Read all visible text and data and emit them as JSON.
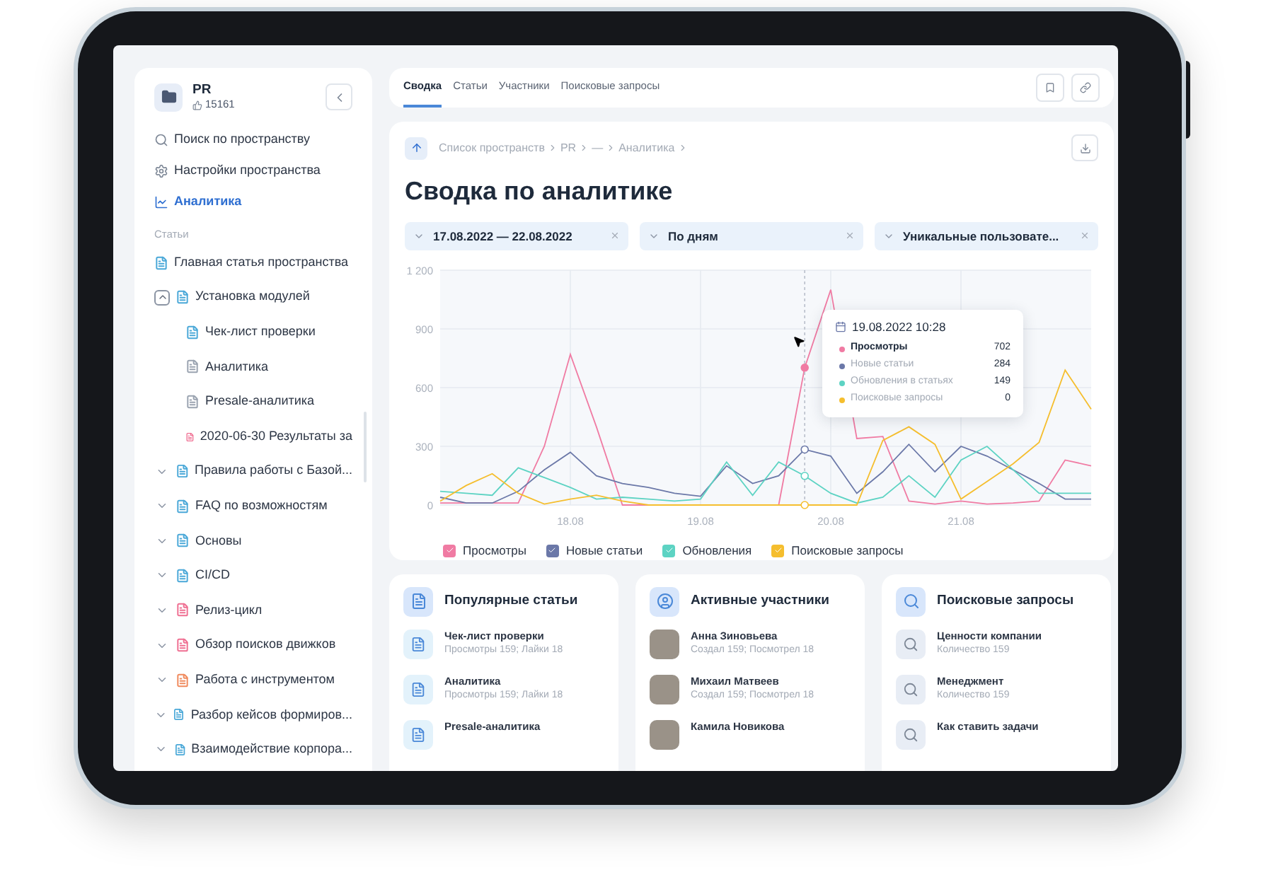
{
  "sidebar": {
    "space": {
      "name": "PR",
      "likes": "15161"
    },
    "nav": [
      {
        "kind": "search",
        "label": "Поиск по пространству",
        "selected": false
      },
      {
        "kind": "settings",
        "label": "Настройки пространства",
        "selected": false
      },
      {
        "kind": "analytics",
        "label": "Аналитика",
        "selected": true
      }
    ],
    "section_label": "Статьи",
    "tree": [
      {
        "kind": "page",
        "label": "Главная статья пространства",
        "color": "#4aa8d8"
      },
      {
        "kind": "folder",
        "label": "Установка модулей",
        "color": "#4aa8d8",
        "expanded": true,
        "children": [
          {
            "label": "Чек-лист проверки",
            "color": "#4aa8d8"
          },
          {
            "label": "Аналитика",
            "color": "#9aa3b0"
          },
          {
            "label": "Presale-аналитика",
            "color": "#9aa3b0"
          },
          {
            "label": "2020-06-30 Результаты за",
            "color": "#ef6f92"
          }
        ]
      },
      {
        "kind": "folder",
        "label": "Правила работы с Базой...",
        "color": "#4aa8d8",
        "expanded": false
      },
      {
        "kind": "folder",
        "label": "FAQ по возможностям",
        "color": "#4aa8d8",
        "expanded": false
      },
      {
        "kind": "folder",
        "label": "Основы",
        "color": "#4aa8d8",
        "expanded": false
      },
      {
        "kind": "folder",
        "label": "CI/CD",
        "color": "#4aa8d8",
        "expanded": false
      },
      {
        "kind": "folder",
        "label": "Релиз-цикл",
        "color": "#ef6f92",
        "expanded": false
      },
      {
        "kind": "folder",
        "label": "Обзор поисков движков",
        "color": "#ef6f92",
        "expanded": false
      },
      {
        "kind": "folder",
        "label": "Работа с инструментом",
        "color": "#f08a5d",
        "expanded": false
      },
      {
        "kind": "folder",
        "label": "Разбор кейсов формиров...",
        "color": "#4aa8d8",
        "expanded": false
      },
      {
        "kind": "folder",
        "label": "Взаимодействие корпора...",
        "color": "#4aa8d8",
        "expanded": false
      }
    ]
  },
  "tabs": [
    {
      "label": "Сводка",
      "selected": true
    },
    {
      "label": "Статьи",
      "selected": false
    },
    {
      "label": "Участники",
      "selected": false
    },
    {
      "label": "Поисковые запросы",
      "selected": false
    }
  ],
  "breadcrumbs": [
    "Список пространств",
    "PR",
    "—",
    "Аналитика"
  ],
  "title": "Сводка по аналитике",
  "filters": [
    {
      "value": "17.08.2022 — 22.08.2022"
    },
    {
      "value": "По дням"
    },
    {
      "value": "Уникальные пользовате..."
    }
  ],
  "chart_data": {
    "type": "line",
    "ylim": [
      0,
      1200
    ],
    "categories": [
      null,
      null,
      null,
      null,
      null,
      "18.08",
      null,
      null,
      null,
      null,
      "19.08",
      null,
      null,
      null,
      null,
      "20.08",
      null,
      null,
      null,
      null,
      "21.08",
      null,
      null,
      null,
      null,
      null
    ],
    "yticks": [
      0,
      300,
      600,
      900,
      {
        "value": 1200,
        "label": "1 200"
      }
    ],
    "series": [
      {
        "name": "Просмотры",
        "color": "#f07ba3",
        "values": [
          10,
          10,
          10,
          10,
          300,
          770,
          400,
          0,
          0,
          0,
          0,
          0,
          0,
          0,
          702,
          1100,
          340,
          350,
          20,
          5,
          20,
          5,
          10,
          20,
          230,
          200
        ]
      },
      {
        "name": "Новые статьи",
        "color": "#6b78a8",
        "values": [
          40,
          10,
          10,
          70,
          180,
          270,
          150,
          110,
          90,
          60,
          45,
          200,
          110,
          150,
          284,
          250,
          60,
          170,
          310,
          170,
          300,
          250,
          180,
          110,
          30,
          30
        ]
      },
      {
        "name": "Обновления",
        "color": "#5dd3c3",
        "values": [
          70,
          60,
          50,
          190,
          140,
          90,
          30,
          40,
          30,
          20,
          30,
          220,
          50,
          220,
          149,
          60,
          10,
          40,
          150,
          40,
          230,
          300,
          180,
          60,
          60,
          60
        ]
      },
      {
        "name": "Поисковые запросы",
        "color": "#f5be2e",
        "values": [
          20,
          100,
          160,
          60,
          5,
          30,
          50,
          20,
          0,
          0,
          0,
          0,
          0,
          0,
          0,
          0,
          0,
          330,
          400,
          310,
          30,
          120,
          210,
          320,
          690,
          490
        ]
      }
    ],
    "grid": true
  },
  "legend": [
    {
      "checked": true
    },
    {
      "checked": true
    },
    {
      "checked": true
    },
    {
      "checked": true
    }
  ],
  "tooltip": {
    "date": "19.08.2022 10:28",
    "rows": [
      {
        "label": "Просмотры",
        "value": "702",
        "color": "#f07ba3",
        "selected": true
      },
      {
        "label": "Новые статьи",
        "value": "284",
        "color": "#6b78a8",
        "selected": false
      },
      {
        "label": "Обновления в статьях",
        "value": "149",
        "color": "#5dd3c3",
        "selected": false
      },
      {
        "label": "Поисковые запросы",
        "value": "0",
        "color": "#f5be2e",
        "selected": false
      }
    ]
  },
  "panels": [
    {
      "kind": "articles",
      "title": "Популярные статьи",
      "items": [
        {
          "title": "Чек-лист проверки",
          "subtitle": "Просмотры 159; Лайки 18"
        },
        {
          "title": "Аналитика",
          "subtitle": "Просмотры 159; Лайки 18"
        },
        {
          "title": "Presale-аналитика"
        }
      ]
    },
    {
      "kind": "members",
      "title": "Активные участники",
      "items": [
        {
          "title": "Анна Зиновьева",
          "subtitle": "Создал 159; Посмотрел 18"
        },
        {
          "title": "Михаил Матвеев",
          "subtitle": "Создал 159; Посмотрел 18"
        },
        {
          "title": "Камила Новикова"
        }
      ]
    },
    {
      "kind": "queries",
      "title": "Поисковые запросы",
      "items": [
        {
          "title": "Ценности компании",
          "subtitle": "Количество 159"
        },
        {
          "title": "Менеджмент",
          "subtitle": "Количество 159"
        },
        {
          "title": "Как ставить задачи"
        }
      ]
    }
  ]
}
